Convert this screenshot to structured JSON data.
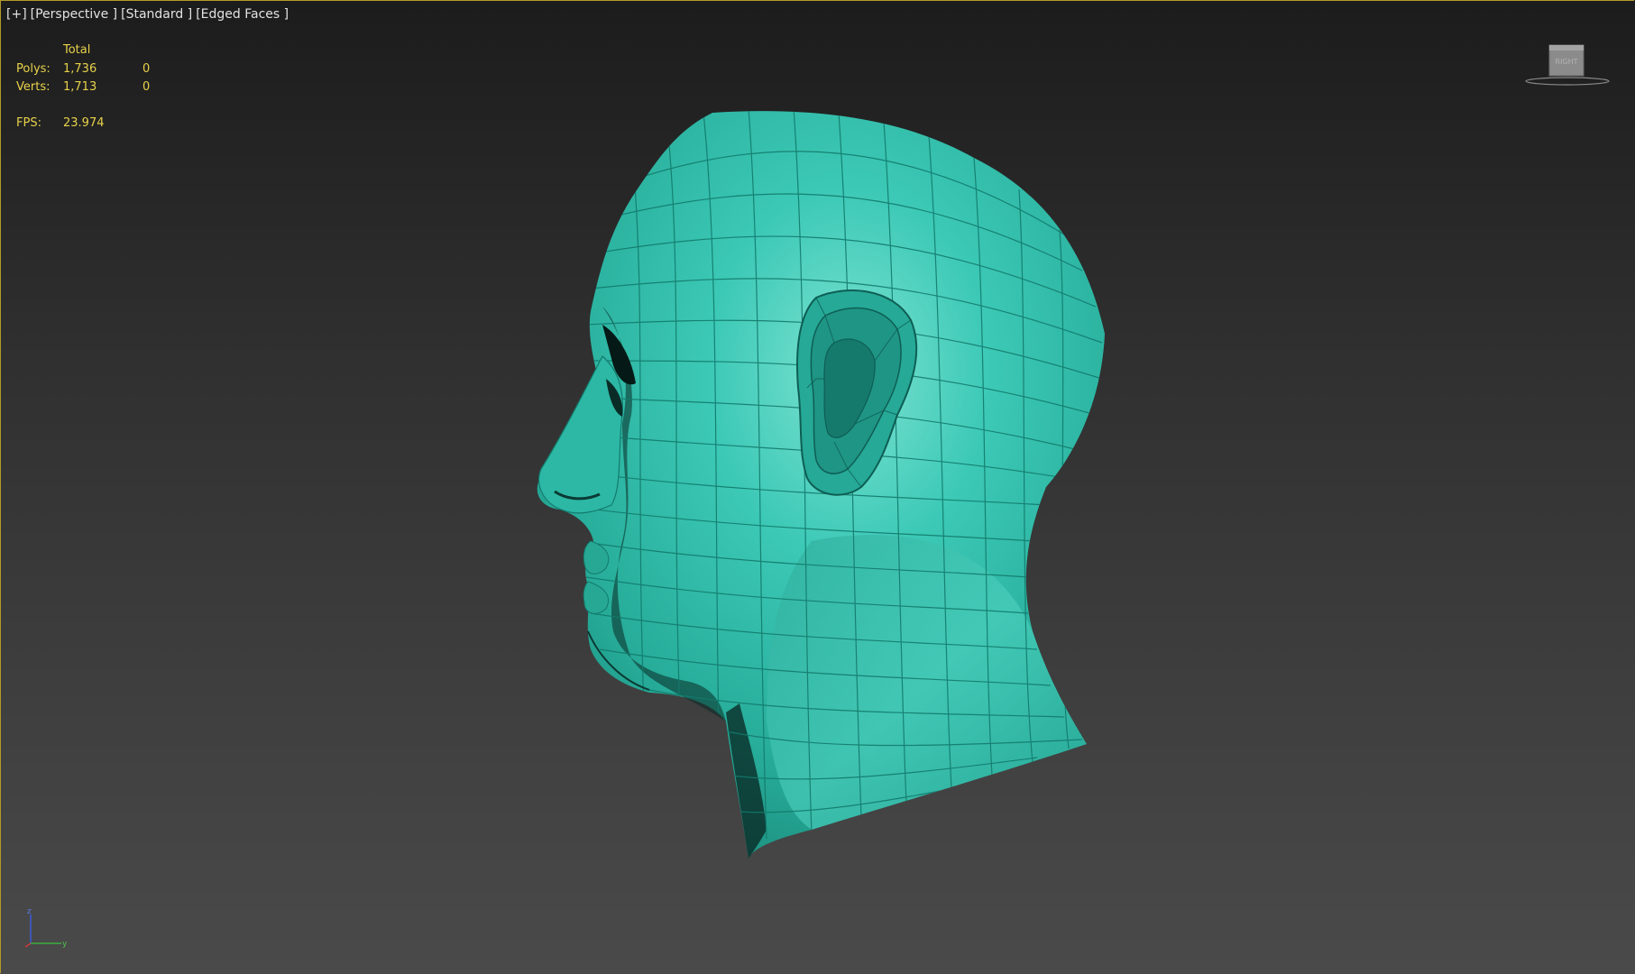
{
  "viewport": {
    "label": {
      "plus": "[+]",
      "view": "[Perspective ]",
      "shading": "[Standard ]",
      "display": "[Edged Faces ]"
    }
  },
  "stats": {
    "header": "Total",
    "rows": [
      {
        "name": "Polys:",
        "total": "1,736",
        "selected": "0"
      },
      {
        "name": "Verts:",
        "total": "1,713",
        "selected": "0"
      }
    ],
    "fps_label": "FPS:",
    "fps_value": "23.974"
  },
  "viewcube": {
    "face_label": "RIGHT",
    "icon": "viewcube-icon"
  },
  "axis_tripod": {
    "z": "z",
    "y": "y",
    "icon": "axis-tripod-icon"
  },
  "model": {
    "icon": "head-mesh",
    "color": "#2fbfaa",
    "edge_color": "#168a7a"
  },
  "colors": {
    "stats_text": "#e8d24a",
    "label_text": "#e2e2e2",
    "viewport_border": "#b39a2a"
  }
}
